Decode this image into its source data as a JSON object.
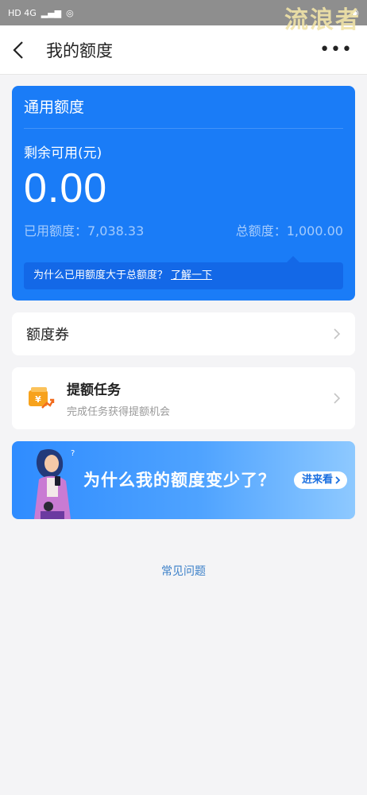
{
  "status_bar": {
    "left": "HD 4G",
    "watermark": "流浪者"
  },
  "nav": {
    "title": "我的额度",
    "more": "•••"
  },
  "quota_card": {
    "title": "通用额度",
    "remaining_label": "剩余可用(元)",
    "remaining_amount": "0.00",
    "used_label": "已用额度：7,038.33",
    "total_label": "总额度：1,000.00",
    "hint_text": "为什么已用额度大于总额度？",
    "hint_link": "了解一下"
  },
  "voucher": {
    "label": "额度券"
  },
  "task": {
    "title": "提额任务",
    "subtitle": "完成任务获得提额机会"
  },
  "banner": {
    "text": "为什么我的额度变少了？",
    "button": "进来看"
  },
  "faq": {
    "label": "常见问题"
  },
  "colors": {
    "accent": "#1a7cf7",
    "page_bg": "#f4f4f6",
    "link": "#3a7fc8"
  }
}
